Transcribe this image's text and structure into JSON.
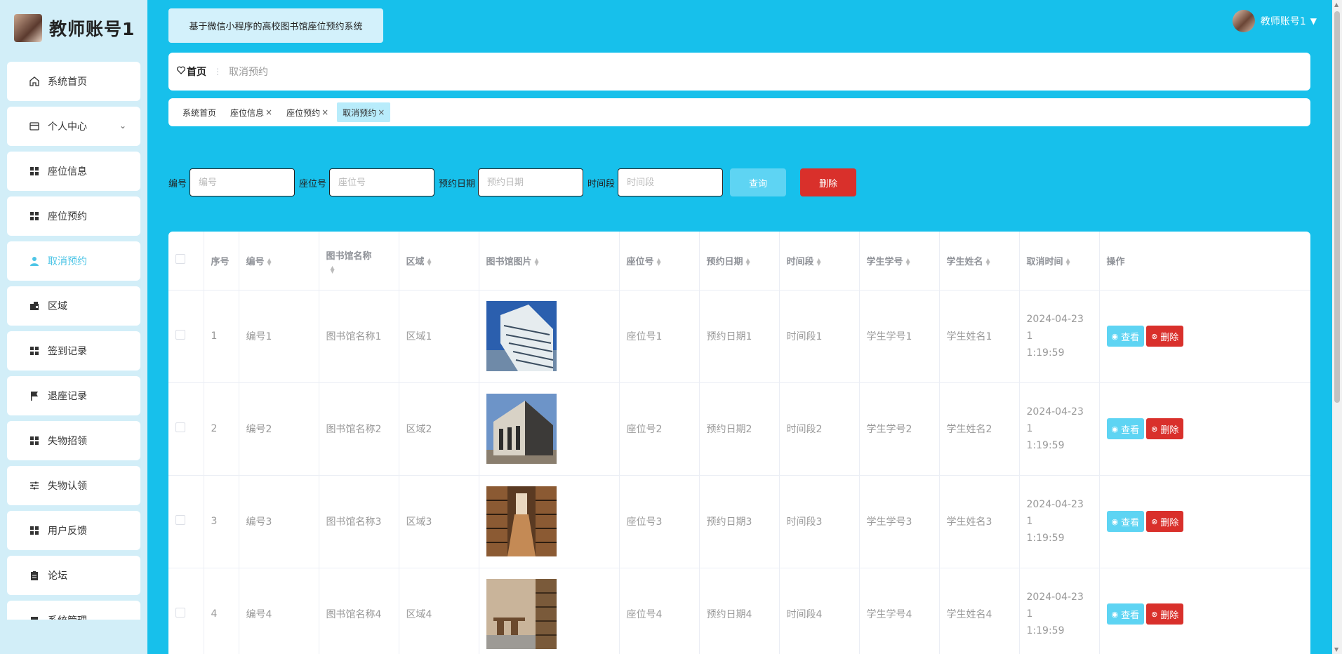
{
  "app": {
    "account_title": "教师账号1",
    "system_title": "基于微信小程序的高校图书馆座位预约系统",
    "user_name": "教师账号1"
  },
  "sidebar": {
    "items": [
      {
        "label": "系统首页",
        "icon": "home-icon"
      },
      {
        "label": "个人中心",
        "icon": "card-icon",
        "has_children": true
      },
      {
        "label": "座位信息",
        "icon": "grid-icon"
      },
      {
        "label": "座位预约",
        "icon": "grid-icon"
      },
      {
        "label": "取消预约",
        "icon": "user-icon",
        "active": true
      },
      {
        "label": "区域",
        "icon": "wallet-icon"
      },
      {
        "label": "签到记录",
        "icon": "grid-icon"
      },
      {
        "label": "退座记录",
        "icon": "flag-icon"
      },
      {
        "label": "失物招领",
        "icon": "grid-icon"
      },
      {
        "label": "失物认领",
        "icon": "sliders-icon"
      },
      {
        "label": "用户反馈",
        "icon": "grid-icon"
      },
      {
        "label": "论坛",
        "icon": "clipboard-icon"
      },
      {
        "label": "系统管理",
        "icon": "clipboard-icon",
        "has_children": true
      }
    ]
  },
  "breadcrumb": {
    "home": "首页",
    "current": "取消预约"
  },
  "tags": [
    {
      "label": "系统首页",
      "closable": false
    },
    {
      "label": "座位信息",
      "closable": true
    },
    {
      "label": "座位预约",
      "closable": true
    },
    {
      "label": "取消预约",
      "closable": true,
      "active": true
    }
  ],
  "search": {
    "fields": [
      {
        "label": "编号",
        "placeholder": "编号"
      },
      {
        "label": "座位号",
        "placeholder": "座位号"
      },
      {
        "label": "预约日期",
        "placeholder": "预约日期"
      },
      {
        "label": "时间段",
        "placeholder": "时间段"
      }
    ],
    "query_label": "查询",
    "delete_label": "删除"
  },
  "table": {
    "columns": [
      "序号",
      "编号",
      "图书馆名称",
      "区域",
      "图书馆图片",
      "座位号",
      "预约日期",
      "时间段",
      "学生学号",
      "学生姓名",
      "取消时间",
      "操作"
    ],
    "view_label": "查看",
    "delete_label": "删除",
    "rows": [
      {
        "index": "1",
        "code": "编号1",
        "library": "图书馆名称1",
        "area": "区域1",
        "seat": "座位号1",
        "date": "预约日期1",
        "period": "时间段1",
        "student_no": "学生学号1",
        "student_name": "学生姓名1",
        "cancel_time_1": "2024-04-23 1",
        "cancel_time_2": "1:19:59"
      },
      {
        "index": "2",
        "code": "编号2",
        "library": "图书馆名称2",
        "area": "区域2",
        "seat": "座位号2",
        "date": "预约日期2",
        "period": "时间段2",
        "student_no": "学生学号2",
        "student_name": "学生姓名2",
        "cancel_time_1": "2024-04-23 1",
        "cancel_time_2": "1:19:59"
      },
      {
        "index": "3",
        "code": "编号3",
        "library": "图书馆名称3",
        "area": "区域3",
        "seat": "座位号3",
        "date": "预约日期3",
        "period": "时间段3",
        "student_no": "学生学号3",
        "student_name": "学生姓名3",
        "cancel_time_1": "2024-04-23 1",
        "cancel_time_2": "1:19:59"
      },
      {
        "index": "4",
        "code": "编号4",
        "library": "图书馆名称4",
        "area": "区域4",
        "seat": "座位号4",
        "date": "预约日期4",
        "period": "时间段4",
        "student_no": "学生学号4",
        "student_name": "学生姓名4",
        "cancel_time_1": "2024-04-23 1",
        "cancel_time_2": "1:19:59"
      }
    ]
  },
  "colors": {
    "background": "#17c0eb",
    "sidebar": "#d2eef8",
    "accent": "#4ec5e6",
    "danger": "#d9302b"
  }
}
